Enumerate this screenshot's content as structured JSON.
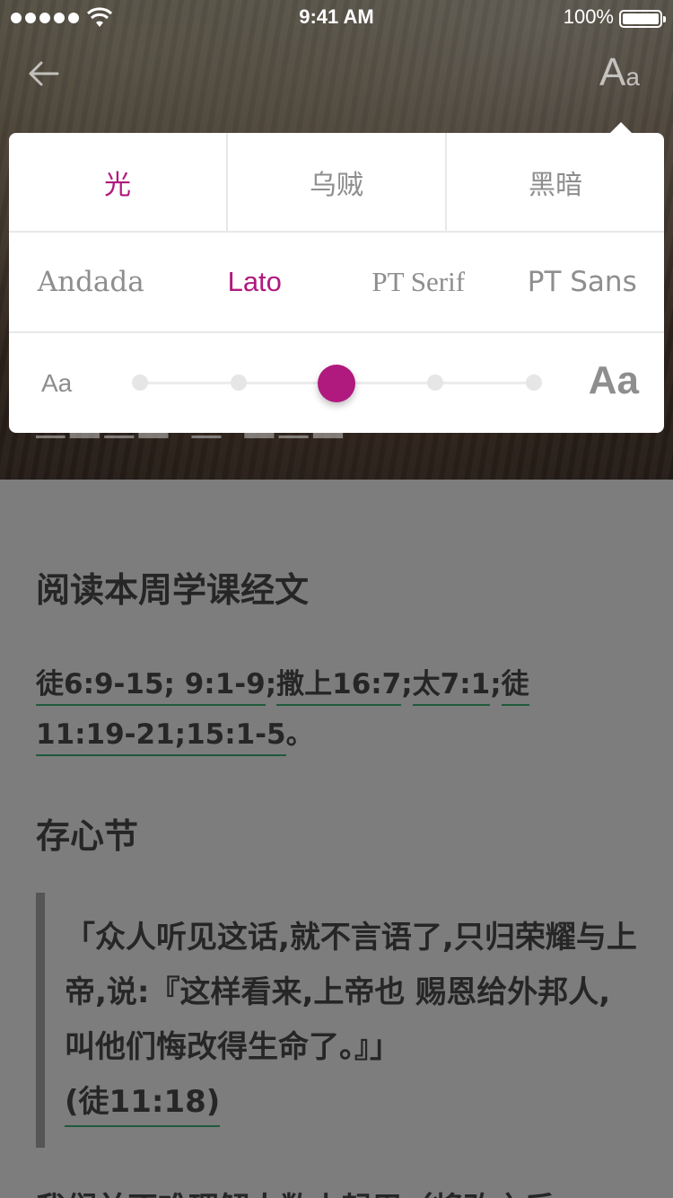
{
  "status_bar": {
    "time": "9:41 AM",
    "battery_percent": "100%"
  },
  "toolbar": {
    "back_icon": "back-arrow-icon",
    "font_toggle_big": "A",
    "font_toggle_small": "a"
  },
  "settings_popover": {
    "themes": [
      {
        "label": "光",
        "active": true
      },
      {
        "label": "乌贼",
        "active": false
      },
      {
        "label": "黑暗",
        "active": false
      }
    ],
    "fonts": [
      {
        "label": "Andada",
        "active": false
      },
      {
        "label": "Lato",
        "active": true
      },
      {
        "label": "PT Serif",
        "active": false
      },
      {
        "label": "PT Sans",
        "active": false
      }
    ],
    "size_small_label": "Aa",
    "size_large_label": "Aa",
    "size_steps": 5,
    "size_selected_index": 2,
    "accent_color": "#b0197e"
  },
  "content": {
    "section1_title": "阅读本周学课经文",
    "references": [
      "徒6:9-15; 9:1-9",
      ";",
      "撒上16:7",
      ";",
      "太7:1",
      ";",
      "徒 11:19-21;15:1-5",
      "。"
    ],
    "section2_title": "存心节",
    "memory_verse": "「众人听见这话,就不言语了,只归荣耀与上帝,说:『这样看来,上帝也 赐恩给外邦人,叫他们悔改得生命了。』」",
    "memory_verse_ref": "(徒11:18)",
    "next_paragraph_start": "我们并不难理解人数小起用（将改之后"
  }
}
